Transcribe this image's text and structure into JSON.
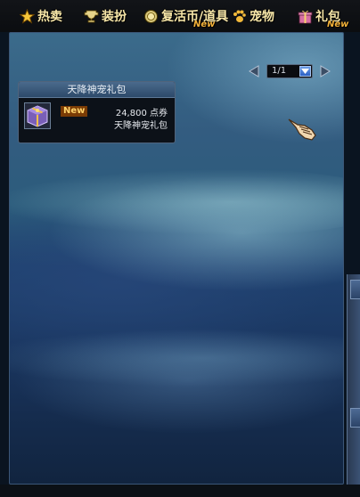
{
  "tabs": [
    {
      "label": "热卖",
      "icon": "star-icon",
      "new": ""
    },
    {
      "label": "装扮",
      "icon": "trophy-icon",
      "new": ""
    },
    {
      "label": "复活币/道具",
      "icon": "coin-icon",
      "new": "New"
    },
    {
      "label": "宠物",
      "icon": "paw-icon",
      "new": ""
    },
    {
      "label": "礼包",
      "icon": "gift-icon",
      "new": "New"
    }
  ],
  "pager": {
    "current": "1/1"
  },
  "item": {
    "title": "天降神宠礼包",
    "badge": "New",
    "price": "24,800 点券",
    "name": "天降神宠礼包",
    "icon": "gift-box-icon"
  },
  "colors": {
    "tab_text": "#f7e6a8",
    "new_tag": "#f3b23a",
    "panel_top": "#3b6b8b",
    "panel_bottom": "#11243f"
  }
}
